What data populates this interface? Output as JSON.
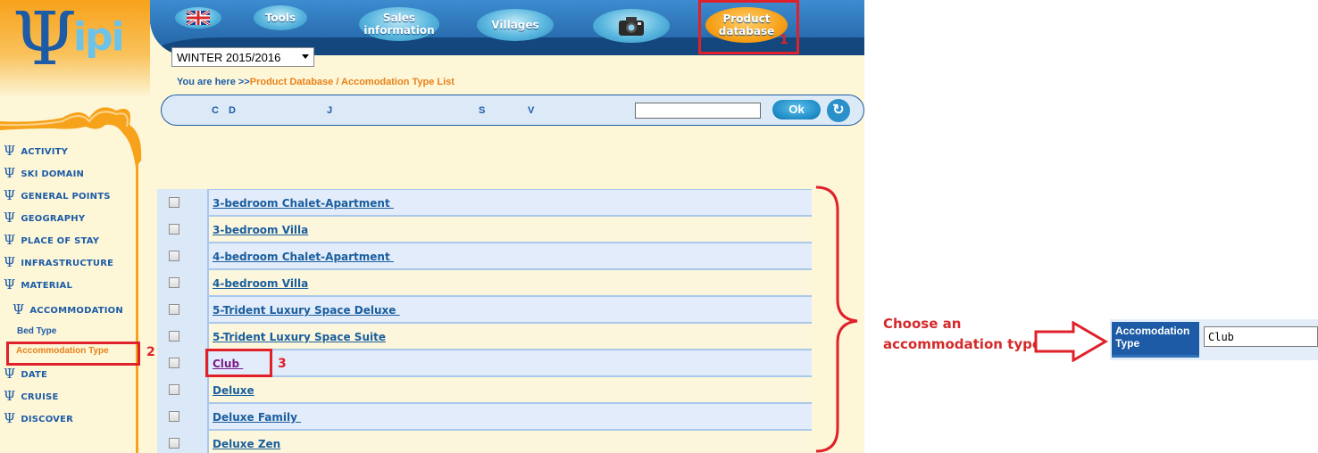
{
  "header": {
    "tools": "Tools",
    "sales_information": "Sales\ninformation",
    "villages": "Villages",
    "product_database": "Product\ndatabase"
  },
  "logo": {
    "symbol": "Ψ",
    "text": "ipi"
  },
  "season": {
    "selected": "WINTER 2015/2016"
  },
  "breadcrumb": {
    "prefix": "You are here >>",
    "path": "Product Database / Accomodation Type List"
  },
  "letters": [
    "C",
    "D",
    "J",
    "S",
    "V"
  ],
  "search": {
    "value": "",
    "ok_label": "Ok",
    "refresh_icon": "↻"
  },
  "sidebar": {
    "items": [
      {
        "label": "ACTIVITY"
      },
      {
        "label": "SKI DOMAIN"
      },
      {
        "label": "GENERAL POINTS"
      },
      {
        "label": "GEOGRAPHY"
      },
      {
        "label": "PLACE OF STAY"
      },
      {
        "label": "INFRASTRUCTURE"
      },
      {
        "label": "MATERIAL"
      }
    ],
    "accommodation": "ACCOMMODATION",
    "bed_type": "Bed Type",
    "accommodation_type": "Accommodation Type",
    "lower_items": [
      {
        "label": "DATE"
      },
      {
        "label": "CRUISE"
      },
      {
        "label": "DISCOVER"
      }
    ]
  },
  "list": {
    "rows": [
      {
        "name": "3-bedroom Chalet-Apartment "
      },
      {
        "name": "3-bedroom Villa"
      },
      {
        "name": "4-bedroom Chalet-Apartment "
      },
      {
        "name": "4-bedroom Villa"
      },
      {
        "name": "5-Trident Luxury Space Deluxe "
      },
      {
        "name": "5-Trident Luxury Space Suite"
      },
      {
        "name": "Club "
      },
      {
        "name": "Deluxe"
      },
      {
        "name": "Deluxe Family "
      },
      {
        "name": "Deluxe Zen"
      }
    ]
  },
  "annotations": {
    "step1": "1",
    "step2": "2",
    "step3": "3",
    "callout_line1": "Choose an",
    "callout_line2": "accommodation type"
  },
  "detail": {
    "label": "Accomodation Type",
    "value": "Club"
  },
  "colors": {
    "accent_red": "#e0202a",
    "brand_blue": "#1d5ba6",
    "brand_orange": "#f7a21b"
  }
}
